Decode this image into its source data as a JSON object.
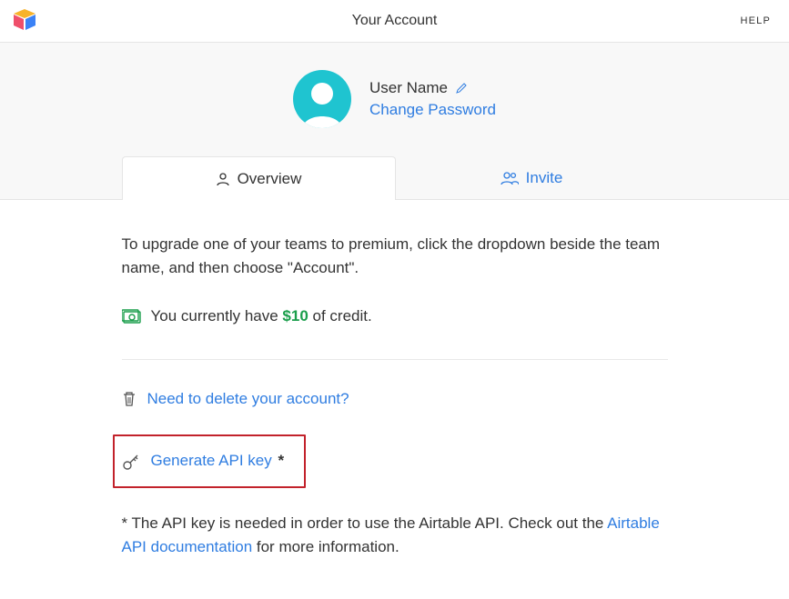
{
  "header": {
    "title": "Your Account",
    "help": "HELP"
  },
  "profile": {
    "user_name": "User Name",
    "change_password": "Change Password"
  },
  "tabs": {
    "overview": "Overview",
    "invite": "Invite"
  },
  "content": {
    "upgrade_text": "To upgrade one of your teams to premium, click the dropdown beside the team name, and then choose \"Account\".",
    "credit_prefix": "You currently have ",
    "credit_amount": "$10",
    "credit_suffix": " of credit.",
    "delete_link": "Need to delete your account?",
    "api_key_link": "Generate API key",
    "api_key_asterisk": "*",
    "api_note_prefix": "* The API key is needed in order to use the Airtable API. Check out the ",
    "api_note_link": "Airtable API documentation",
    "api_note_suffix": " for more information."
  }
}
